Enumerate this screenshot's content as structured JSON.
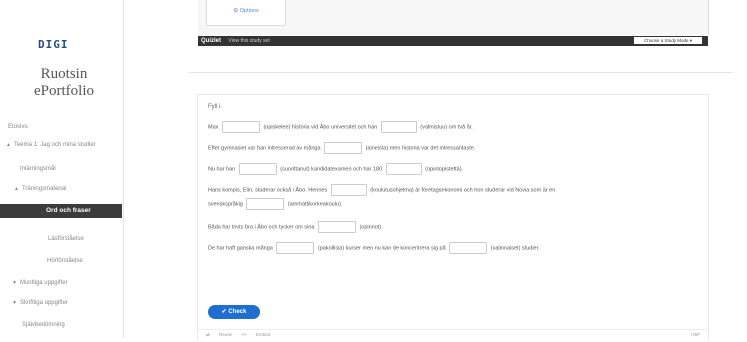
{
  "sidebar": {
    "logo": "DIGI",
    "title": "Ruotsin ePortfolio",
    "items": [
      {
        "label": "Etusivu"
      },
      {
        "label": "Teema 1: Jag och mina studier"
      },
      {
        "label": "Inlärningsmål"
      },
      {
        "label": "Träningsmaterial"
      },
      {
        "label": "Ord och fraser"
      },
      {
        "label": "Läsförståelse"
      },
      {
        "label": "Hörförståelse"
      },
      {
        "label": "Muntliga uppgifter"
      },
      {
        "label": "Skriftliga uppgifter"
      },
      {
        "label": "Självbedömning"
      }
    ]
  },
  "embed": {
    "options_label": "Options",
    "quizlet_logo": "Quizlet",
    "quizlet_link": "View this study set",
    "study_mode": "Choose a Study Mode"
  },
  "exercise": {
    "title": "Fyll i.",
    "line1": {
      "a": "Max",
      "b": "(opiskelee) historia vid Åbo universitet och han",
      "c": "(valmistuu) om två år."
    },
    "line2": {
      "a": "Efter gymnasiet var han intresserad av många",
      "b": "(aineista) men historia var det intressantaste."
    },
    "line3": {
      "a": "Nu har han",
      "b": "(suorittanut) kandidatexamen och har 180",
      "c": "(opintopistettä)."
    },
    "line4": {
      "a": "Hans kompis, Elin, studerar också i Åbo. Hennes",
      "b": "(koulutusohjelma) är företagsekonomi och hon studerar vid Novia som är en"
    },
    "line5": {
      "a": "svenskspråkig",
      "b": "(ammattikorkeakoulu)."
    },
    "line6": {
      "a": "Båda har trivts bra i Åbo och tycker om sina",
      "b": "(opinnot)."
    },
    "line7": {
      "a": "De har haft ganska många",
      "b": "(pakollisia) kurser men nu kan de koncentrera sig på",
      "c": "(valinnaiset) studier."
    },
    "check_label": "Check",
    "footer_reuse": "Reuse",
    "footer_embed": "Embed",
    "footer_h5p": "H5P"
  }
}
